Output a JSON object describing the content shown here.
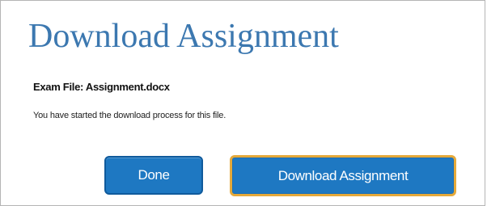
{
  "dialog": {
    "title": "Download Assignment",
    "file_label": "Exam File: Assignment.docx",
    "message": "You have started the download process for this file."
  },
  "buttons": {
    "done_label": "Done",
    "download_label": "Download Assignment"
  },
  "colors": {
    "title": "#3c78b0",
    "button_bg": "#1e78c2",
    "focus_ring": "#e5a93a"
  }
}
